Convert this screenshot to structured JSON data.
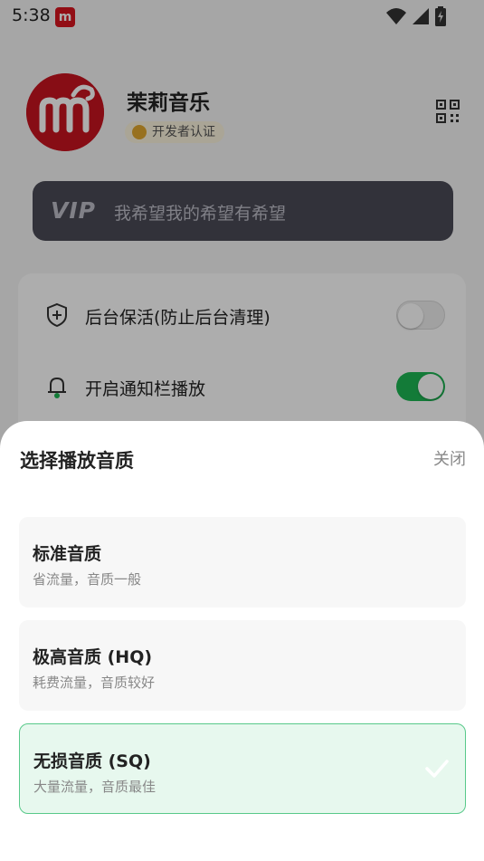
{
  "status_bar": {
    "time": "5:38",
    "app_icon_text": "m"
  },
  "profile": {
    "name": "茉莉音乐",
    "badge": "开发者认证"
  },
  "vip": {
    "logo": "VIP",
    "slogan": "我希望我的希望有希望"
  },
  "settings": [
    {
      "label": "后台保活(防止后台清理)",
      "icon": "shield-plus-icon",
      "enabled": false
    },
    {
      "label": "开启通知栏播放",
      "icon": "bell-icon",
      "enabled": true
    }
  ],
  "sheet": {
    "title": "选择播放音质",
    "close_label": "关闭",
    "options": [
      {
        "title": "标准音质",
        "subtitle": "省流量，音质一般",
        "selected": false
      },
      {
        "title": "极高音质 (HQ)",
        "subtitle": "耗费流量，音质较好",
        "selected": false
      },
      {
        "title": "无损音质 (SQ)",
        "subtitle": "大量流量，音质最佳",
        "selected": true
      }
    ]
  },
  "colors": {
    "accent": "#1db553",
    "selected_bg": "#e7f8ee",
    "vip_card": "#4a4a56",
    "brand_red": "#c8141f"
  }
}
